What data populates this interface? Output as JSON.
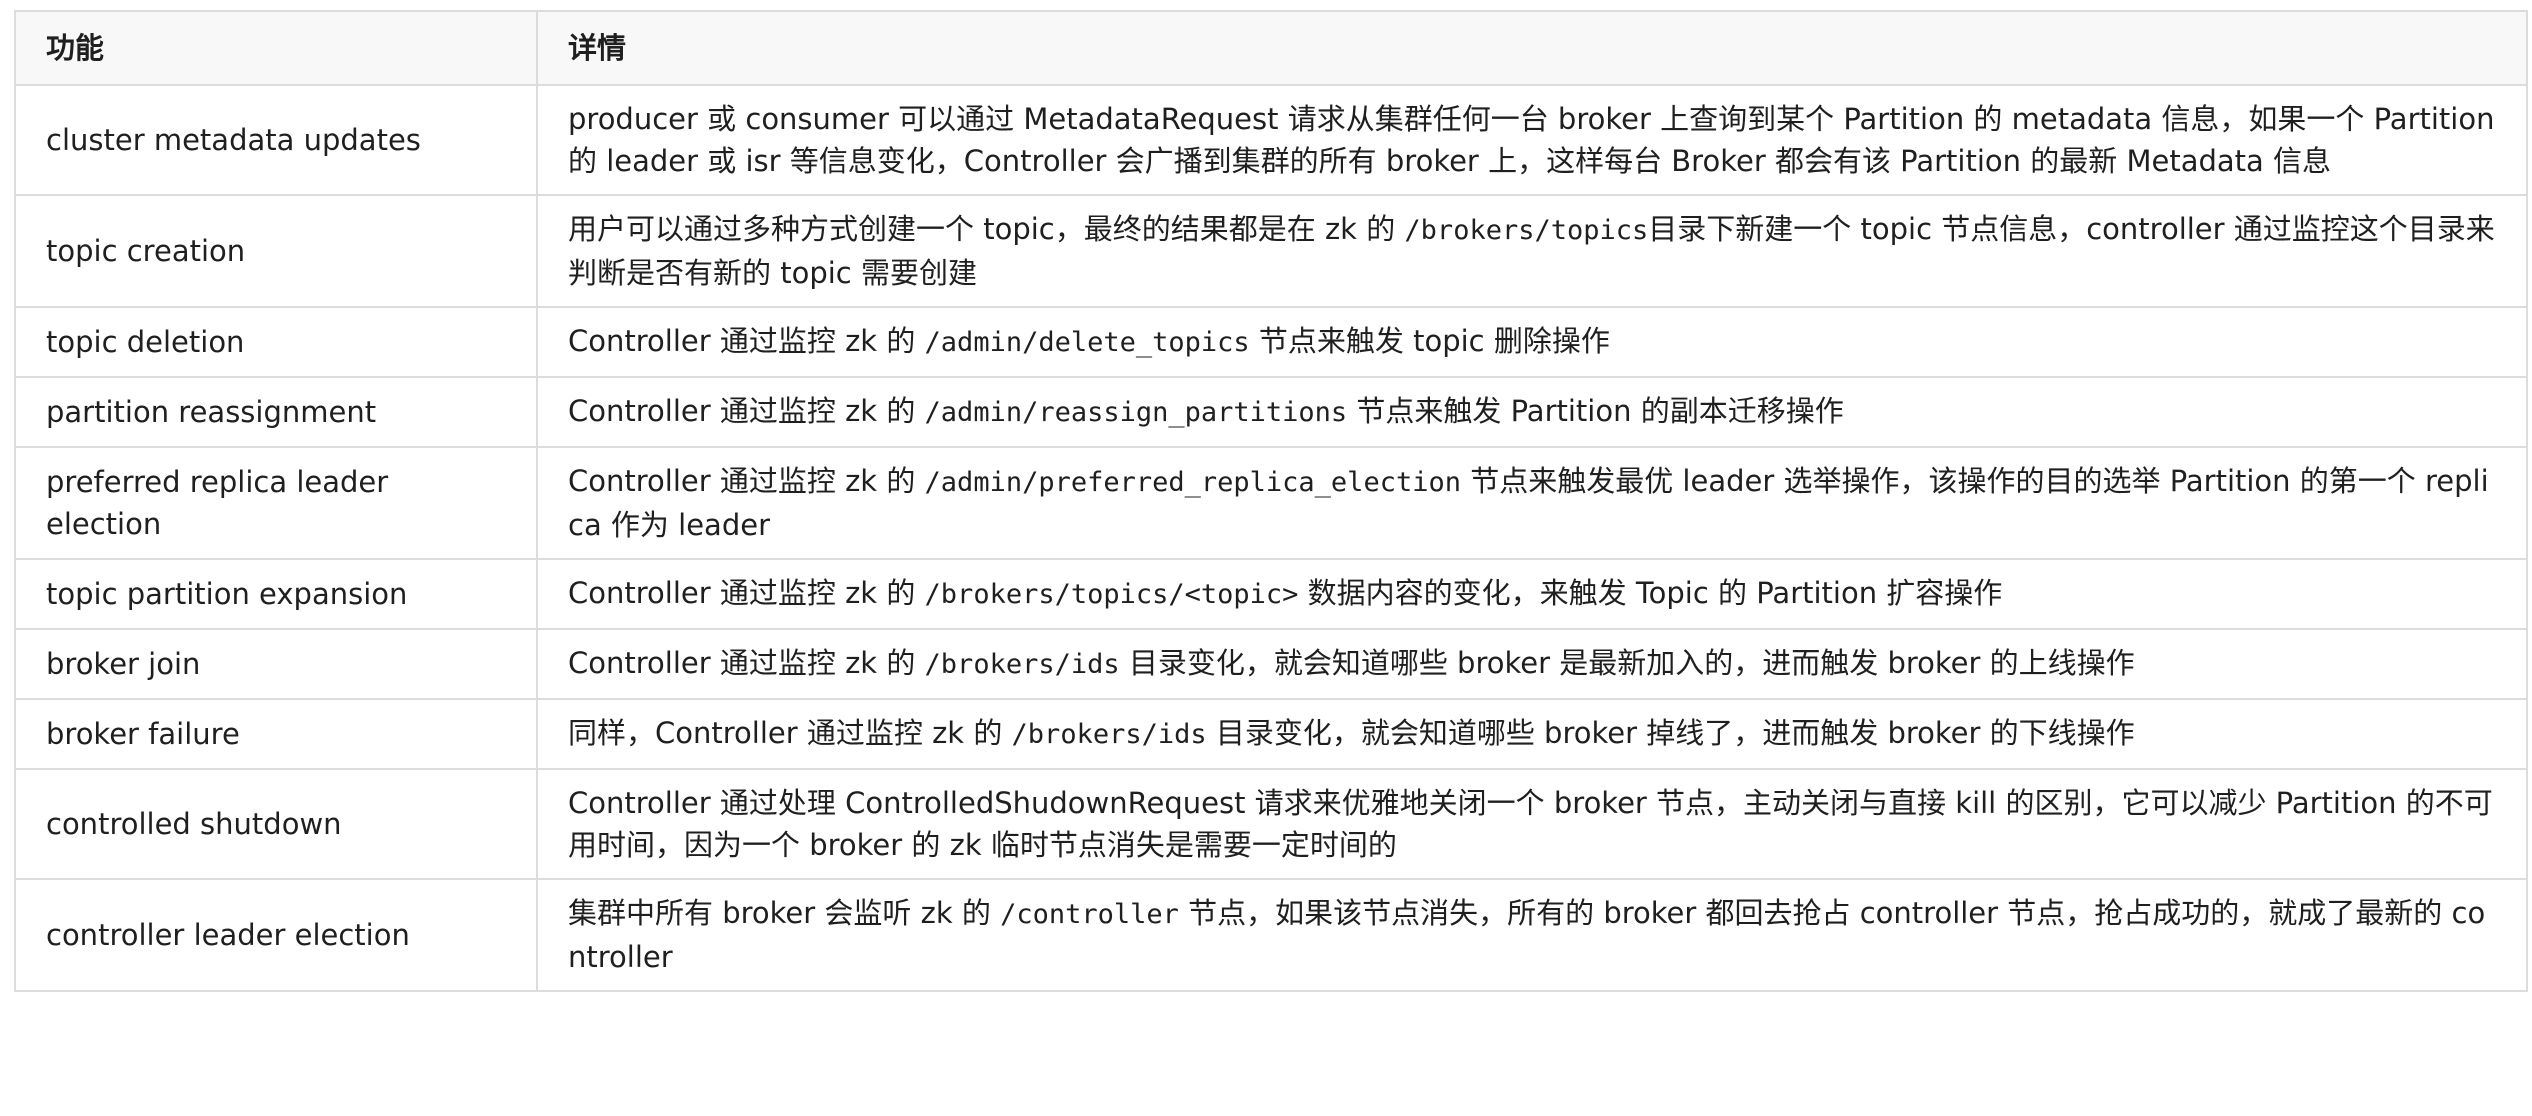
{
  "table": {
    "headers": [
      "功能",
      "详情"
    ],
    "rows": [
      {
        "name": "cluster metadata updates",
        "detail": [
          {
            "t": "producer 或 consumer 可以通过 MetadataRequest 请求从集群任何一台 broker 上查询到某个 Partition 的 metadata 信息，如果一个 Partition 的 leader 或 isr 等信息变化，Controller 会广播到集群的所有 broker 上，这样每台 Broker 都会有该 Partition 的最新 Metadata 信息"
          }
        ]
      },
      {
        "name": "topic creation",
        "detail": [
          {
            "t": "用户可以通过多种方式创建一个 topic，最终的结果都是在 zk 的 "
          },
          {
            "c": "/brokers/topics"
          },
          {
            "t": "目录下新建一个 topic 节点信息，controller 通过监控这个目录来判断是否有新的 topic 需要创建"
          }
        ]
      },
      {
        "name": "topic deletion",
        "detail": [
          {
            "t": "Controller 通过监控 zk 的 "
          },
          {
            "c": "/admin/delete_topics"
          },
          {
            "t": " 节点来触发 topic 删除操作"
          }
        ]
      },
      {
        "name": "partition reassignment",
        "detail": [
          {
            "t": "Controller 通过监控 zk 的 "
          },
          {
            "c": "/admin/reassign_partitions"
          },
          {
            "t": " 节点来触发 Partition 的副本迁移操作"
          }
        ]
      },
      {
        "name": "preferred replica leader election",
        "detail": [
          {
            "t": "Controller 通过监控 zk 的 "
          },
          {
            "c": "/admin/preferred_replica_election"
          },
          {
            "t": " 节点来触发最优 leader 选举操作，该操作的目的选举 Partition 的第一个 replica 作为 leader"
          }
        ]
      },
      {
        "name": "topic partition expansion",
        "detail": [
          {
            "t": "Controller 通过监控 zk 的 "
          },
          {
            "c": "/brokers/topics/<topic>"
          },
          {
            "t": " 数据内容的变化，来触发 Topic 的 Partition 扩容操作"
          }
        ]
      },
      {
        "name": "broker join",
        "detail": [
          {
            "t": "Controller 通过监控 zk 的 "
          },
          {
            "c": "/brokers/ids"
          },
          {
            "t": " 目录变化，就会知道哪些 broker 是最新加入的，进而触发 broker 的上线操作"
          }
        ]
      },
      {
        "name": "broker failure",
        "detail": [
          {
            "t": "同样，Controller 通过监控 zk 的 "
          },
          {
            "c": "/brokers/ids"
          },
          {
            "t": " 目录变化，就会知道哪些 broker 掉线了，进而触发 broker 的下线操作"
          }
        ]
      },
      {
        "name": "controlled shutdown",
        "detail": [
          {
            "t": "Controller 通过处理 ControlledShudownRequest 请求来优雅地关闭一个 broker 节点，主动关闭与直接 kill 的区别，它可以减少 Partition 的不可用时间，因为一个 broker 的 zk 临时节点消失是需要一定时间的"
          }
        ]
      },
      {
        "name": "controller leader election",
        "detail": [
          {
            "t": "集群中所有 broker 会监听 zk 的 "
          },
          {
            "c": "/controller"
          },
          {
            "t": " 节点，如果该节点消失，所有的 broker 都回去抢占 controller 节点，抢占成功的，就成了最新的 controller"
          }
        ]
      }
    ]
  }
}
